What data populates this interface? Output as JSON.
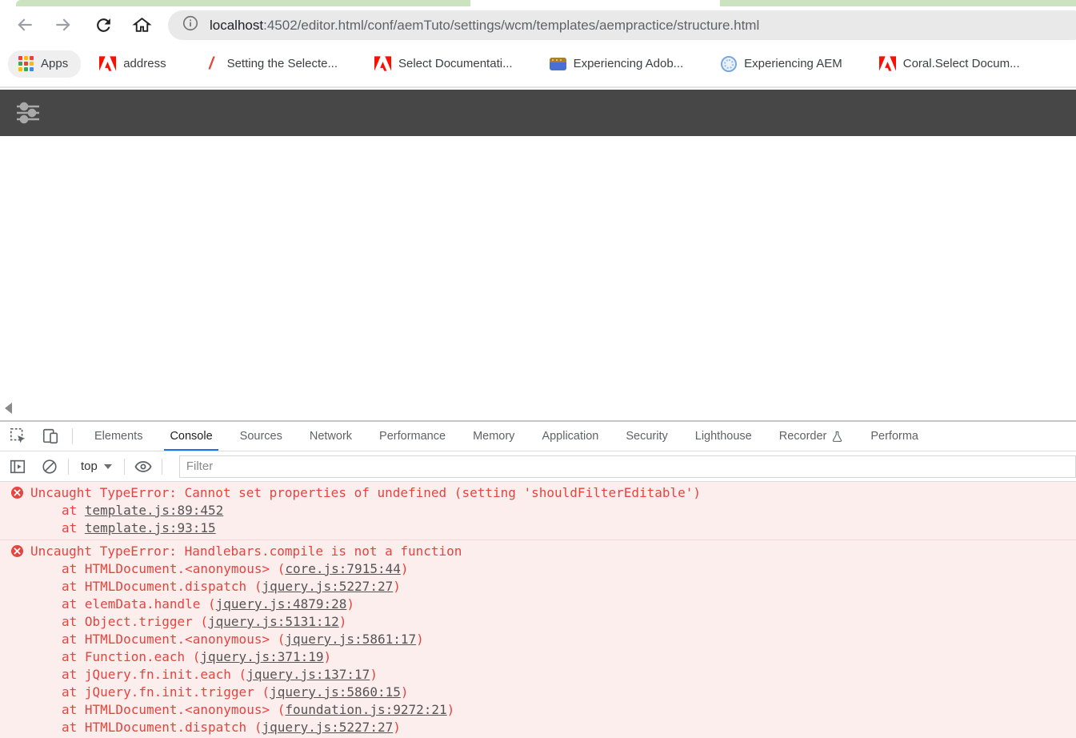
{
  "browser": {
    "nav": {
      "back_icon": "arrow-left",
      "forward_icon": "arrow-right",
      "reload_icon": "reload",
      "home_icon": "home"
    },
    "omnibox": {
      "scheme_icon": "info",
      "domain": "localhost",
      "path": ":4502/editor.html/conf/aemTuto/settings/wcm/templates/aempractice/structure.html"
    },
    "bookmarks_bar": {
      "apps_label": "Apps",
      "items": [
        {
          "label": "address",
          "icon": "adobe"
        },
        {
          "label": "Setting the Selecte...",
          "icon": "red-slash"
        },
        {
          "label": "Select Documentati...",
          "icon": "adobe"
        },
        {
          "label": "Experiencing Adob...",
          "icon": "folder-gold-blue"
        },
        {
          "label": "Experiencing AEM",
          "icon": "blue-ring"
        },
        {
          "label": "Coral.Select Docum...",
          "icon": "adobe"
        }
      ]
    }
  },
  "aem_editor": {
    "toolbar_icon": "sliders-icon",
    "toolbar_color": "#474747"
  },
  "devtools": {
    "tabbar": {
      "inspect_icon": "inspect-element",
      "device_icon": "device-toolbar",
      "tabs": [
        {
          "label": "Elements",
          "active": false
        },
        {
          "label": "Console",
          "active": true
        },
        {
          "label": "Sources",
          "active": false
        },
        {
          "label": "Network",
          "active": false
        },
        {
          "label": "Performance",
          "active": false
        },
        {
          "label": "Memory",
          "active": false
        },
        {
          "label": "Application",
          "active": false
        },
        {
          "label": "Security",
          "active": false
        },
        {
          "label": "Lighthouse",
          "active": false
        },
        {
          "label": "Recorder",
          "active": false,
          "flask_icon": true
        },
        {
          "label": "Performa",
          "active": false,
          "truncated": true
        }
      ]
    },
    "console_toolbar": {
      "sidebar_icon": "show-console-sidebar",
      "clear_icon": "clear-console",
      "context_selected": "top",
      "live_expression_icon": "eye",
      "filter_placeholder": "Filter"
    },
    "console_errors": [
      {
        "message": "Uncaught TypeError: Cannot set properties of undefined (setting 'shouldFilterEditable')",
        "frames": [
          {
            "fn": "",
            "link": "template.js:89:452"
          },
          {
            "fn": "",
            "link": "template.js:93:15"
          }
        ]
      },
      {
        "message": "Uncaught TypeError: Handlebars.compile is not a function",
        "frames": [
          {
            "fn": "HTMLDocument.<anonymous>",
            "link": "core.js:7915:44"
          },
          {
            "fn": "HTMLDocument.dispatch",
            "link": "jquery.js:5227:27"
          },
          {
            "fn": "elemData.handle",
            "link": "jquery.js:4879:28"
          },
          {
            "fn": "Object.trigger",
            "link": "jquery.js:5131:12"
          },
          {
            "fn": "HTMLDocument.<anonymous>",
            "link": "jquery.js:5861:17"
          },
          {
            "fn": "Function.each",
            "link": "jquery.js:371:19"
          },
          {
            "fn": "jQuery.fn.init.each",
            "link": "jquery.js:137:17"
          },
          {
            "fn": "jQuery.fn.init.trigger",
            "link": "jquery.js:5860:15"
          },
          {
            "fn": "HTMLDocument.<anonymous>",
            "link": "foundation.js:9272:21"
          },
          {
            "fn": "HTMLDocument.dispatch",
            "link": "jquery.js:5227:27"
          }
        ]
      }
    ]
  },
  "colors": {
    "error_text": "#e5443f",
    "error_bg": "#fdeeee",
    "active_tab_underline": "#1a73e8",
    "adobe_red": "#fa0f00",
    "aem_toolbar": "#474747",
    "tab_strip_green": "#cbe3bf"
  }
}
